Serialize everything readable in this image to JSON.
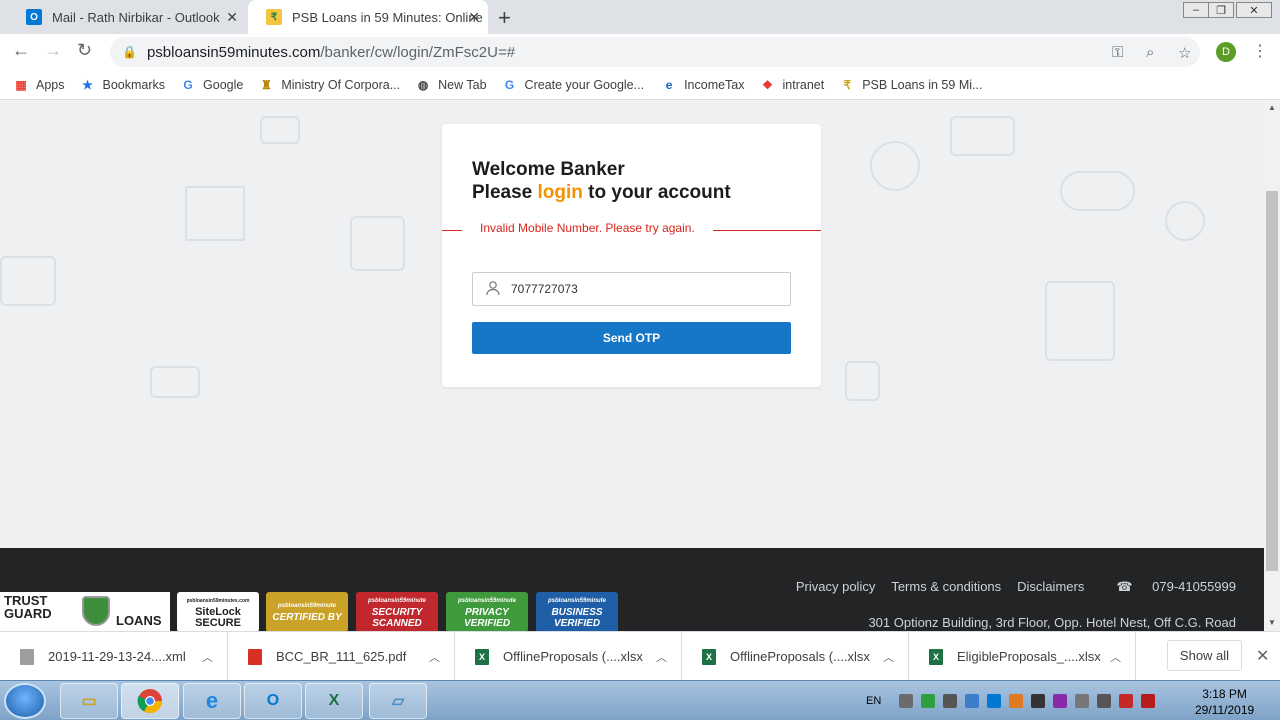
{
  "browser": {
    "tabs": [
      {
        "title": "Mail - Rath Nirbikar - Outlook",
        "icon": "outlook-icon",
        "color": "#0078d4"
      },
      {
        "title": "PSB Loans in 59 Minutes: Online",
        "icon": "psb-icon",
        "color": "#4caf50"
      }
    ],
    "url": {
      "host": "psbloansin59minutes.com",
      "path": "/banker/cw/login/ZmFsc2U=#"
    },
    "profile_initial": "D",
    "bookmarks": [
      {
        "label": "Apps",
        "icon": "apps-grid-icon"
      },
      {
        "label": "Bookmarks",
        "icon": "star-icon"
      },
      {
        "label": "Google",
        "icon": "google-icon"
      },
      {
        "label": "Ministry Of Corpora...",
        "icon": "emblem-icon"
      },
      {
        "label": "New Tab",
        "icon": "globe-icon"
      },
      {
        "label": "Create your Google...",
        "icon": "google-icon"
      },
      {
        "label": "IncomeTax",
        "icon": "ie-icon"
      },
      {
        "label": "intranet",
        "icon": "intranet-icon"
      },
      {
        "label": "PSB Loans in 59 Mi...",
        "icon": "psb-icon"
      }
    ]
  },
  "login": {
    "line1": "Welcome Banker",
    "line2_pre": "Please ",
    "line2_hl": "login",
    "line2_post": " to your account",
    "error": "Invalid Mobile Number. Please try again.",
    "mobile_value": "7077727073",
    "send_otp": "Send OTP"
  },
  "footer": {
    "links": [
      "Privacy policy",
      "Terms & conditions",
      "Disclaimers"
    ],
    "phone": "079-41055999",
    "address": "301 Optionz Building, 3rd Floor, Opp. Hotel Nest, Off C.G. Road",
    "trustguard": "TRUST GUARD",
    "trustguard_sub": "LOANS",
    "badges": [
      {
        "top": "psbloansin59minutes.com",
        "main": "SiteLock SECURE",
        "color": "#ffffff"
      },
      {
        "top": "psbloansin59minute",
        "main": "CERTIFIED BY",
        "color": "#c9a227"
      },
      {
        "top": "psbloansin59minute",
        "main": "SECURITY SCANNED",
        "color": "#c0282d"
      },
      {
        "top": "psbloansin59minute",
        "main": "PRIVACY VERIFIED",
        "color": "#3e9a3a"
      },
      {
        "top": "psbloansin59minute",
        "main": "BUSINESS VERIFIED",
        "color": "#1f5fa8"
      }
    ]
  },
  "downloads": [
    {
      "name": "2019-11-29-13-24....xml",
      "type": "xml",
      "color": "#9e9e9e"
    },
    {
      "name": "BCC_BR_111_625.pdf",
      "type": "pdf",
      "color": "#d93025"
    },
    {
      "name": "OfflineProposals (....xlsx",
      "type": "xlsx",
      "color": "#1e7145"
    },
    {
      "name": "OfflineProposals (....xlsx",
      "type": "xlsx",
      "color": "#1e7145"
    },
    {
      "name": "EligibleProposals_....xlsx",
      "type": "xlsx",
      "color": "#1e7145"
    }
  ],
  "downloads_show_all": "Show all",
  "taskbar": {
    "lang": "EN",
    "time": "3:18 PM",
    "date": "29/11/2019"
  }
}
